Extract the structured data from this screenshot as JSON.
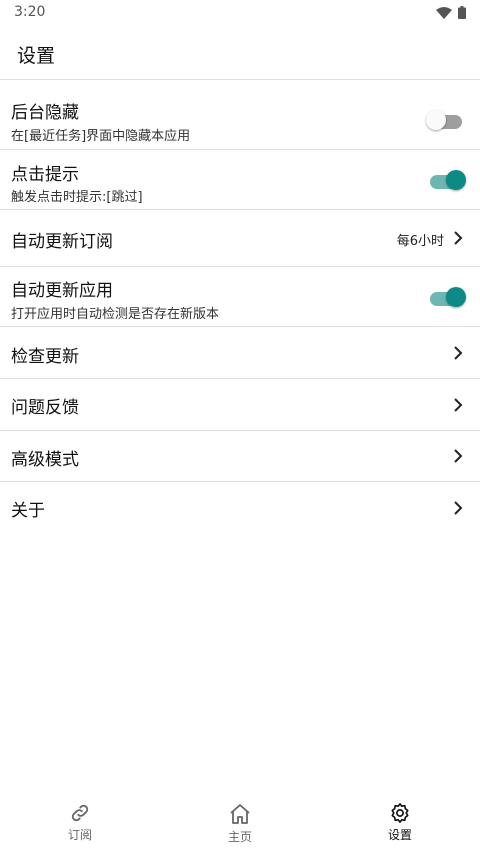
{
  "status_bar": {
    "time": "3:20",
    "wifi_icon": "wifi-icon",
    "battery_icon": "battery-icon"
  },
  "app_bar": {
    "title": "设置"
  },
  "settings": [
    {
      "id": "hide-in-recents",
      "title": "后台隐藏",
      "subtitle": "在[最近任务]界面中隐藏本应用",
      "control": "switch",
      "checked": false
    },
    {
      "id": "click-hint",
      "title": "点击提示",
      "subtitle": "触发点击时提示:[跳过]",
      "control": "switch",
      "checked": true
    },
    {
      "id": "auto-update-subscription",
      "title": "自动更新订阅",
      "value": "每6小时",
      "control": "chevron"
    },
    {
      "id": "auto-update-app",
      "title": "自动更新应用",
      "subtitle": "打开应用时自动检测是否存在新版本",
      "control": "switch",
      "checked": true
    },
    {
      "id": "check-update",
      "title": "检查更新",
      "control": "chevron"
    },
    {
      "id": "feedback",
      "title": "问题反馈",
      "control": "chevron"
    },
    {
      "id": "advanced-mode",
      "title": "高级模式",
      "control": "chevron"
    },
    {
      "id": "about",
      "title": "关于",
      "control": "chevron"
    }
  ],
  "bottom_nav": {
    "items": [
      {
        "id": "subscriptions",
        "label": "订阅",
        "icon": "link-icon",
        "active": false
      },
      {
        "id": "home",
        "label": "主页",
        "icon": "home-icon",
        "active": false
      },
      {
        "id": "settings",
        "label": "设置",
        "icon": "gear-icon",
        "active": true
      }
    ]
  },
  "colors": {
    "accent": "#0b8a86",
    "accent_track": "#6cb7b3",
    "divider": "#e0e0e0",
    "switch_off_track": "#9e9e9e"
  }
}
